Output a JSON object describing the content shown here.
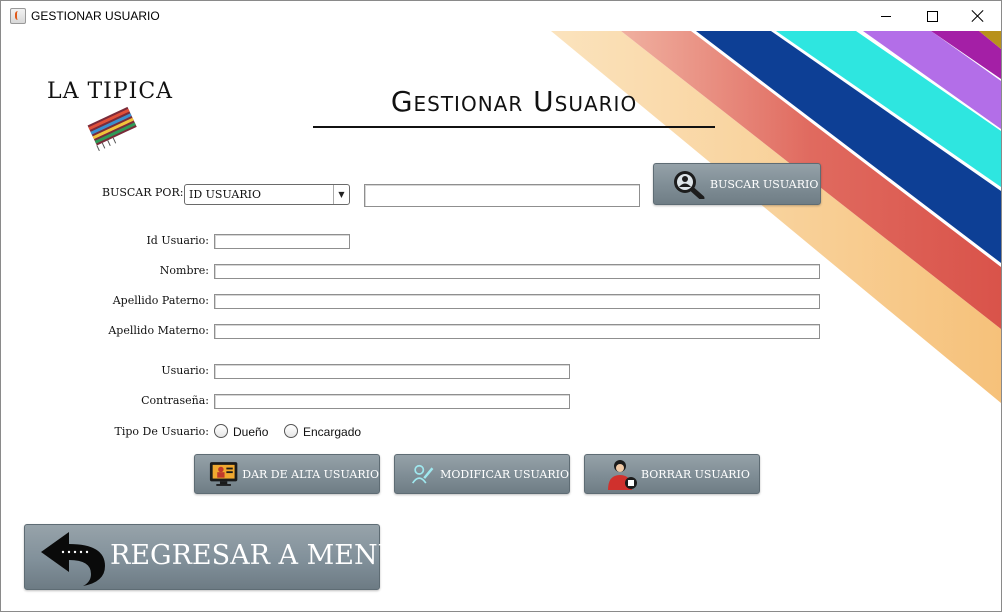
{
  "window": {
    "title": "GESTIONAR USUARIO"
  },
  "logo": {
    "text": "LA TIPICA"
  },
  "header": {
    "title": "Gestionar Usuario"
  },
  "search": {
    "label": "BUSCAR POR:",
    "select_value": "ID USUARIO",
    "input_value": "",
    "button_label": "BUSCAR USUARIO"
  },
  "form": {
    "id_label": "Id Usuario:",
    "nombre_label": "Nombre:",
    "apellido_paterno_label": "Apellido Paterno:",
    "apellido_materno_label": "Apellido Materno:",
    "usuario_label": "Usuario:",
    "contrasena_label": "Contraseña:",
    "tipo_label": "Tipo De Usuario:",
    "tipo_options": [
      "Dueño",
      "Encargado"
    ]
  },
  "actions": {
    "alta_label": "DAR DE ALTA USUARIO",
    "modificar_label": "MODIFICAR USUARIO",
    "borrar_label": "BORRAR USUARIO"
  },
  "back_button": {
    "label": "REGRESAR A MENÚ"
  },
  "colors": {
    "stripe_peach": "#f8cd8f",
    "stripe_red": "#df5f56",
    "stripe_navy": "#0d3f95",
    "stripe_cyan": "#2ee6e0",
    "stripe_violet": "#b36ee8",
    "stripe_magenta": "#a41fa6",
    "stripe_olive": "#b8911b",
    "button_gray": "#7f8d95"
  }
}
